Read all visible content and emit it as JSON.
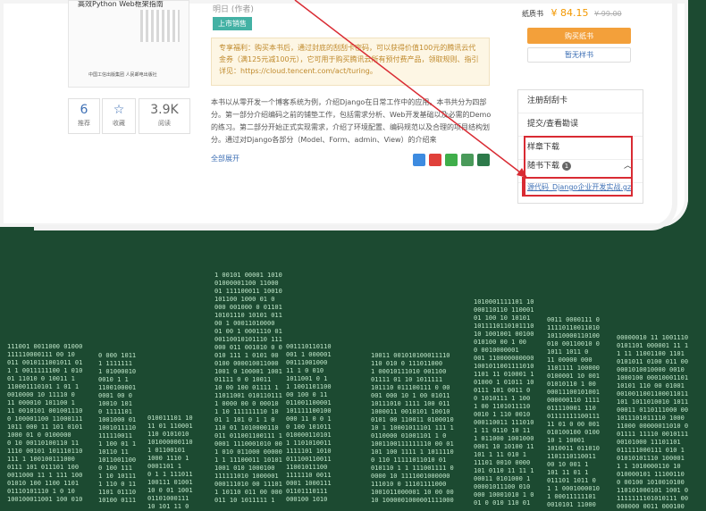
{
  "book": {
    "cover_title": "高效Python Web框架指南",
    "cover_publisher": "中国工信出版集团  人民邮电出版社",
    "author": "明日 (作者)",
    "badge": "上市销售",
    "promo": "专享福利：购买本书后，通过封底的刮刮卡密码，可以获得价值100元的腾讯云代金券（满125元减100元），它可用于购买腾讯云所有预付费产品，领取规则、指引详见：https://cloud.tencent.com/act/turing。",
    "description": "本书以从零开发一个博客系统为例，介绍Django在日常工作中的应用。本书共分为四部分。第一部分介绍编码之前的铺垫工作，包括需求分析、Web开发基础以及必需的Demo的练习。第二部分开始正式实现需求，介绍了环境配置、编码规范以及合理的项目结构划分。通过对Django各部分（Model、Form、admin、View）的介绍来",
    "expand": "全部展开"
  },
  "stats": [
    {
      "value": "6",
      "label": "推荐"
    },
    {
      "value": "☆",
      "label": "收藏"
    },
    {
      "value": "3.9K",
      "label": "阅读"
    }
  ],
  "purchase": {
    "label": "纸质书",
    "price": "¥ 84.15",
    "old_price": "¥ 99.00",
    "buy_label": "购买纸书",
    "sample_label": "暂无样书"
  },
  "sidebar": {
    "items": [
      "注册刮刮卡",
      "提交/查看勘误",
      "样章下载"
    ],
    "download_header": "随书下载",
    "download_count": "1",
    "download_link": "源代码_Django企业开发实战.gz"
  },
  "colors": {
    "background": "#1c4a31",
    "accent": "#f3a03a",
    "highlight": "#d92b33"
  }
}
